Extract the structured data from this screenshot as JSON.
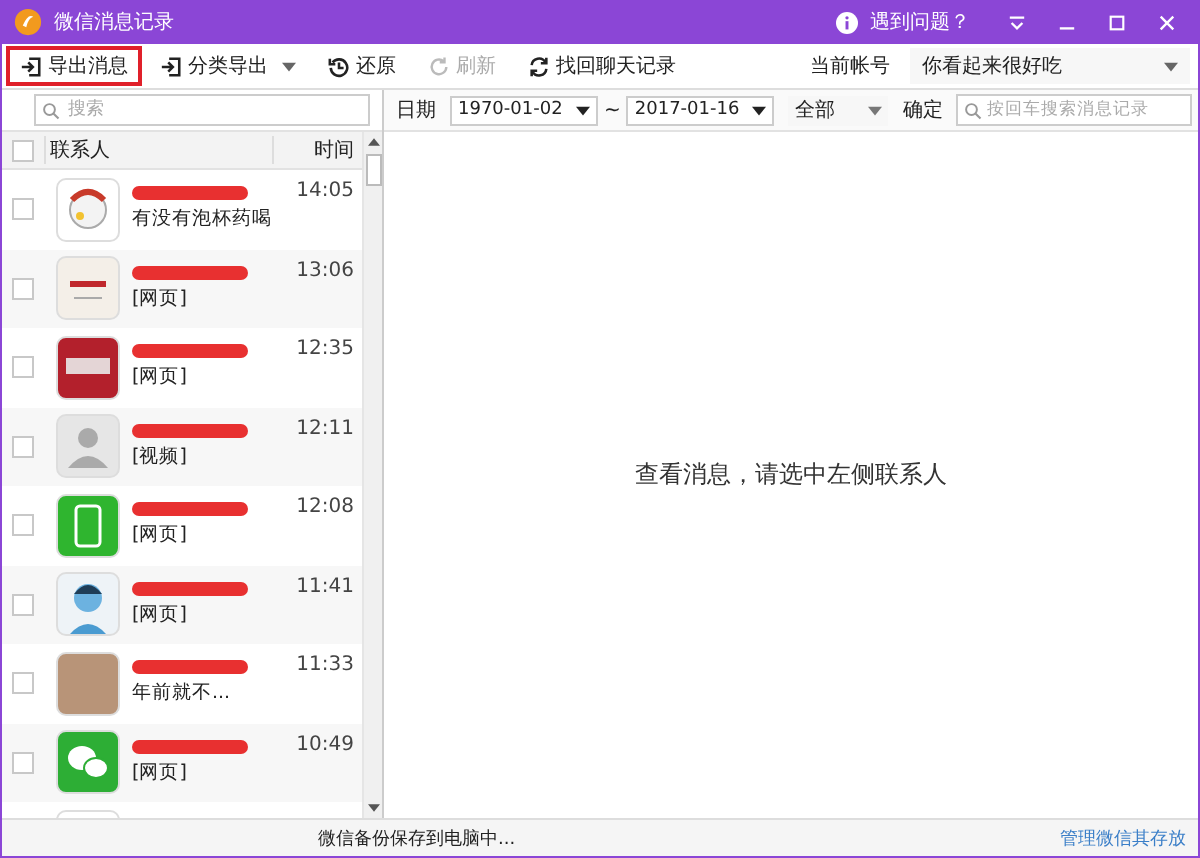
{
  "window": {
    "title": "微信消息记录",
    "help": "遇到问题？"
  },
  "toolbar": {
    "buttons": [
      {
        "label": "导出消息",
        "kind": "export",
        "disabled": false,
        "highlighted": true
      },
      {
        "label": "分类导出",
        "kind": "split",
        "disabled": false,
        "highlighted": false
      },
      {
        "label": "还原",
        "kind": "restore",
        "disabled": false,
        "highlighted": false
      },
      {
        "label": "刷新",
        "kind": "refresh",
        "disabled": true,
        "highlighted": false
      },
      {
        "label": "找回聊天记录",
        "kind": "recover",
        "disabled": false,
        "highlighted": false
      }
    ],
    "account_label": "当前帐号",
    "account": "你看起来很好吃"
  },
  "sidebar": {
    "search_placeholder": "搜索",
    "all_checked": false,
    "columns": [
      "联系人",
      "时间"
    ],
    "contacts": [
      {
        "kind": "cartoon",
        "preview": "有没有泡杯药喝",
        "time": "14:05",
        "checked": false
      },
      {
        "kind": "newspaper",
        "preview": "[网页]",
        "time": "13:06",
        "checked": false
      },
      {
        "kind": "app",
        "preview": "[网页]",
        "time": "12:35",
        "checked": false
      },
      {
        "kind": "silhouette",
        "preview": "[视频]",
        "time": "12:11",
        "checked": false
      },
      {
        "kind": "phone",
        "preview": "[网页]",
        "time": "12:08",
        "checked": false
      },
      {
        "kind": "person",
        "preview": "[网页]",
        "time": "11:41",
        "checked": false
      },
      {
        "kind": "photo",
        "preview": "年前就不...",
        "time": "11:33",
        "checked": false
      },
      {
        "kind": "chat",
        "preview": "[网页]",
        "time": "10:49",
        "checked": false
      },
      {
        "kind": "plain"
      }
    ]
  },
  "filter": {
    "date_label": "日期",
    "from": "1970-01-02",
    "separator": "~",
    "to": "2017-01-16",
    "type": "全部",
    "confirm": "确定",
    "search_placeholder": "按回车搜索消息记录"
  },
  "main": {
    "empty_message": "查看消息，请选中左侧联系人"
  },
  "status_bar": {
    "message": "微信备份保存到电脑中...",
    "link": "管理微信其存放"
  }
}
